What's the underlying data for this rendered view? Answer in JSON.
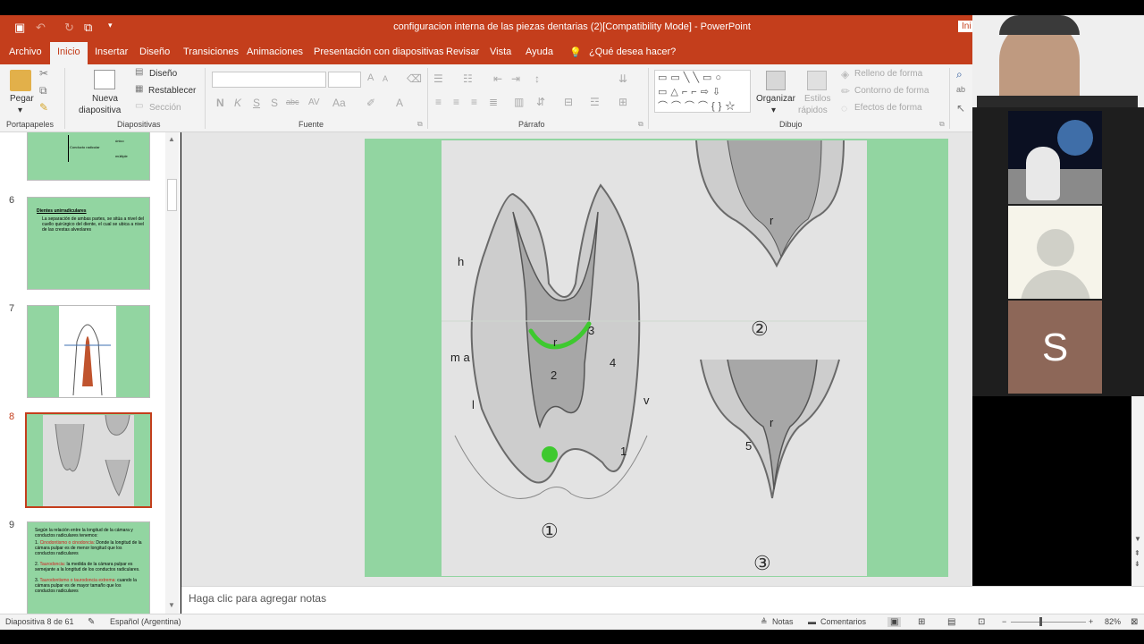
{
  "window": {
    "title": "configuracion interna de las piezas dentarias (2)[Compatibility Mode]  -  PowerPoint",
    "clipped_button": "Ini"
  },
  "tabs": [
    "Archivo",
    "Inicio",
    "Insertar",
    "Diseño",
    "Transiciones",
    "Animaciones",
    "Presentación con diapositivas",
    "Revisar",
    "Vista",
    "Ayuda"
  ],
  "tell_me": "¿Qué desea hacer?",
  "ribbon": {
    "clipboard": {
      "paste": "Pegar",
      "group": "Portapapeles"
    },
    "slides": {
      "new_slide_1": "Nueva",
      "new_slide_2": "diapositiva",
      "layout": "Diseño",
      "reset": "Restablecer",
      "section": "Sección",
      "group": "Diapositivas"
    },
    "font": {
      "group": "Fuente",
      "bold": "N",
      "italic": "K",
      "underline": "S",
      "strike": "S",
      "shadow": "abc",
      "case": "Aa",
      "color": "A"
    },
    "paragraph": {
      "group": "Párrafo"
    },
    "drawing": {
      "arrange": "Organizar",
      "quick_styles_1": "Estilos",
      "quick_styles_2": "rápidos",
      "fill": "Relleno de forma",
      "outline": "Contorno de forma",
      "effects": "Efectos de forma",
      "group": "Dibujo"
    }
  },
  "thumbnails": [
    {
      "num": "",
      "text_single": "único",
      "text_radicular": "Conducto radicular",
      "text_multiple": "múltiple"
    },
    {
      "num": "6",
      "title": "Dientes unirradiculares",
      "body": "La separación de ambas partes, se sitúa a nivel del cuello quirúrgico del diente, el cual se ubica a nivel de las crestas alveolares"
    },
    {
      "num": "7"
    },
    {
      "num": "8"
    },
    {
      "num": "9",
      "intro": "Según la relación entre la longitud de la cámara y conductos radiculares tenemos:",
      "item1_term": "Cinodontismo o cinodoncia:",
      "item1_text": "Donde la longitud de la cámara pulpar es de menor longitud que los conductos radiculares",
      "item2_term": "Taurodoncia:",
      "item2_text": "la medida de la cámara pulpar es semejante a la longitud de los conductos radiculares.",
      "item3_term": "Taurodontismo o taurodoncia extrema:",
      "item3_text": "cuando la cámara pulpar es de mayor tamaño que los conductos radiculares"
    }
  ],
  "slide_labels": {
    "h": "h",
    "ma": "m a",
    "l": "l",
    "r1": "r",
    "three": "3",
    "two": "2",
    "four": "4",
    "v": "v",
    "one": "1",
    "circ1": "①",
    "r2": "r",
    "circ2": "②",
    "r3": "r",
    "five": "5",
    "circ3": "③"
  },
  "notes_placeholder": "Haga clic para agregar notas",
  "status": {
    "slide_info": "Diapositiva 8 de 61",
    "language": "Español (Argentina)",
    "notes": "Notas",
    "comments": "Comentarios",
    "zoom": "82%"
  },
  "video": {
    "avatar_letter": "S"
  },
  "colors": {
    "accent": "#c43e1c",
    "slide_bg": "#92d5a1",
    "annotation": "#3ec92f"
  }
}
